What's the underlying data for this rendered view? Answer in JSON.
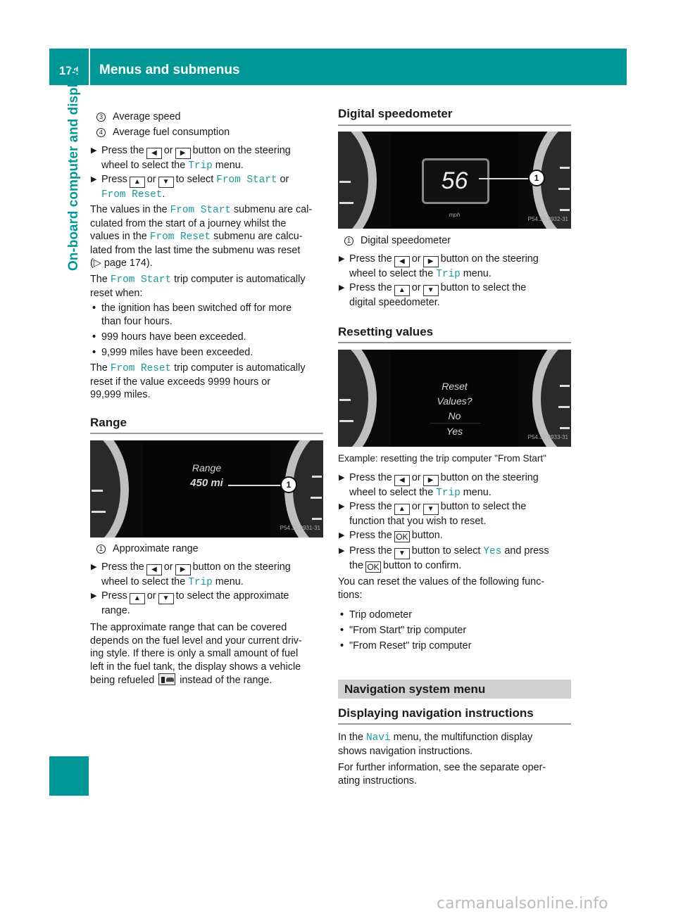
{
  "header": {
    "page_number": "174",
    "title": "Menus and submenus",
    "accent_color": "#009797"
  },
  "side_tab": {
    "label": "On-board computer and displays"
  },
  "left": {
    "legend_top": [
      {
        "num": "3",
        "text": "Average speed"
      },
      {
        "num": "4",
        "text": "Average fuel consumption"
      }
    ],
    "steps1": [
      {
        "pre": "Press the",
        "mid": "or",
        "post": "button on the steering",
        "line2_pre": "wheel to select the",
        "mono": "Trip",
        "line2_post": "menu."
      },
      {
        "pre": "Press",
        "mid": "or",
        "post": "to select",
        "mono1": "From Start",
        "or": "or",
        "mono2": "From Reset",
        "end": "."
      }
    ],
    "para1": {
      "t1": "The values in the",
      "m1": "From Start",
      "t2": "submenu are cal-",
      "l2": "culated from the start of a journey whilst the",
      "t3": "values in the",
      "m2": "From Reset",
      "t4": "submenu are calcu-",
      "l4": "lated from the last time the submenu was reset",
      "l5": "(▷ page 174)."
    },
    "para2": {
      "t1": "The",
      "m1": "From Start",
      "t2": "trip computer is automatically",
      "l2": "reset when:"
    },
    "bullets": [
      {
        "l1": "the ignition has been switched off for more",
        "l2": "than four hours."
      },
      {
        "l1": "999 hours have been exceeded."
      },
      {
        "l1": "9,999 miles have been exceeded."
      }
    ],
    "para3": {
      "t1": "The",
      "m1": "From Reset",
      "t2": "trip computer is automatically",
      "l2": "reset if the value exceeds 9999 hours or",
      "l3": "99,999 miles."
    },
    "range_heading": "Range",
    "range_figure": {
      "title": "Range",
      "value": "450 mi",
      "callout": "1",
      "code": "P54.32-9931-31"
    },
    "range_legend": {
      "num": "1",
      "text": "Approximate range"
    },
    "steps2": [
      {
        "pre": "Press the",
        "mid": "or",
        "post": "button on the steering",
        "line2_pre": "wheel to select the",
        "mono": "Trip",
        "line2_post": "menu."
      },
      {
        "pre": "Press",
        "mid": "or",
        "post": "to select the approximate",
        "line2": "range."
      }
    ],
    "para4": {
      "l1": "The approximate range that can be covered",
      "l2": "depends on the fuel level and your current driv-",
      "l3": "ing style. If there is only a small amount of fuel",
      "l4": "left in the fuel tank, the display shows a vehicle",
      "l5a": "being refueled",
      "l5b": "instead of the range."
    }
  },
  "right": {
    "speedo_heading": "Digital speedometer",
    "speedo_figure": {
      "value": "56",
      "unit": "mph",
      "callout": "1",
      "code": "P54.32-9932-31"
    },
    "speedo_legend": {
      "num": "1",
      "text": "Digital speedometer"
    },
    "steps3": [
      {
        "pre": "Press the",
        "mid": "or",
        "post": "button on the steering",
        "line2_pre": "wheel to select the",
        "mono": "Trip",
        "line2_post": "menu."
      },
      {
        "pre": "Press the",
        "mid": "or",
        "post": "button to select the",
        "line2": "digital speedometer."
      }
    ],
    "reset_heading": "Resetting values",
    "reset_figure": {
      "l1": "Reset",
      "l2": "Values?",
      "l3": "No",
      "l4": "Yes",
      "code": "P54.32-9933-31"
    },
    "reset_caption": "Example: resetting the trip computer \"From Start\"",
    "steps4": [
      {
        "pre": "Press the",
        "mid": "or",
        "post": "button on the steering",
        "line2_pre": "wheel to select the",
        "mono": "Trip",
        "line2_post": "menu."
      },
      {
        "pre": "Press the",
        "mid": "or",
        "post": "button to select the",
        "line2": "function that you wish to reset."
      },
      {
        "pre": "Press the",
        "key": "OK",
        "post": "button."
      },
      {
        "pre": "Press the",
        "post": "button to select",
        "mono": "Yes",
        "post2": "and press",
        "line2_pre": "the",
        "key": "OK",
        "line2_post": "button to confirm."
      }
    ],
    "para5": {
      "l1": "You can reset the values of the following func-",
      "l2": "tions:"
    },
    "bullets2": [
      "Trip odometer",
      "\"From Start\" trip computer",
      "\"From Reset\" trip computer"
    ],
    "nav_band": "Navigation system menu",
    "nav_heading": "Displaying navigation instructions",
    "para6": {
      "t1": "In the",
      "m1": "Navi",
      "t2": "menu, the multifunction display",
      "l2": "shows navigation instructions."
    },
    "para7": {
      "l1": "For further information, see the separate oper-",
      "l2": "ating instructions."
    }
  },
  "keys": {
    "left": "◀",
    "right": "▶",
    "up": "▲",
    "down": "▼"
  },
  "watermark": "carmanualsonline.info"
}
